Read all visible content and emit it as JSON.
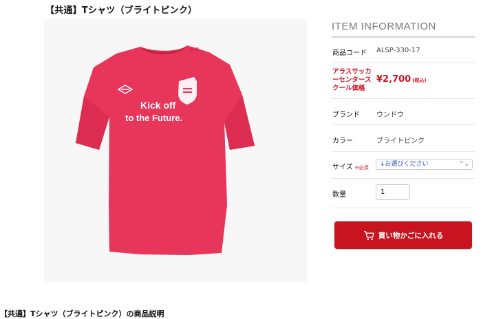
{
  "page_title": "【共通】Tシャツ（ブライトピンク）",
  "product_image": {
    "alt": "ピンクのTシャツ",
    "print_line1": "Kick off",
    "print_line2": "to the Future.",
    "shirt_color": "#e8355a"
  },
  "item_info": {
    "heading": "ITEM INFORMATION",
    "code_label": "商品コード",
    "code_value": "ALSP-330-17",
    "price_label": "アラスサッカーセンタースクール価格",
    "price_value": "¥2,700",
    "price_tax": "(税込)",
    "brand_label": "ブランド",
    "brand_value": "ウンドウ",
    "color_label": "カラー",
    "color_value": "ブライトピンク",
    "size_label": "サイズ",
    "size_required": "※必須",
    "size_placeholder": "↓お選びください",
    "qty_label": "数量",
    "qty_value": "1"
  },
  "cart_button": {
    "label": "買い物かごに入れる"
  },
  "description_title": "【共通】Tシャツ（ブライトピンク）の商品説明",
  "colors": {
    "accent": "#c8141f",
    "border": "#e3e3e3"
  }
}
